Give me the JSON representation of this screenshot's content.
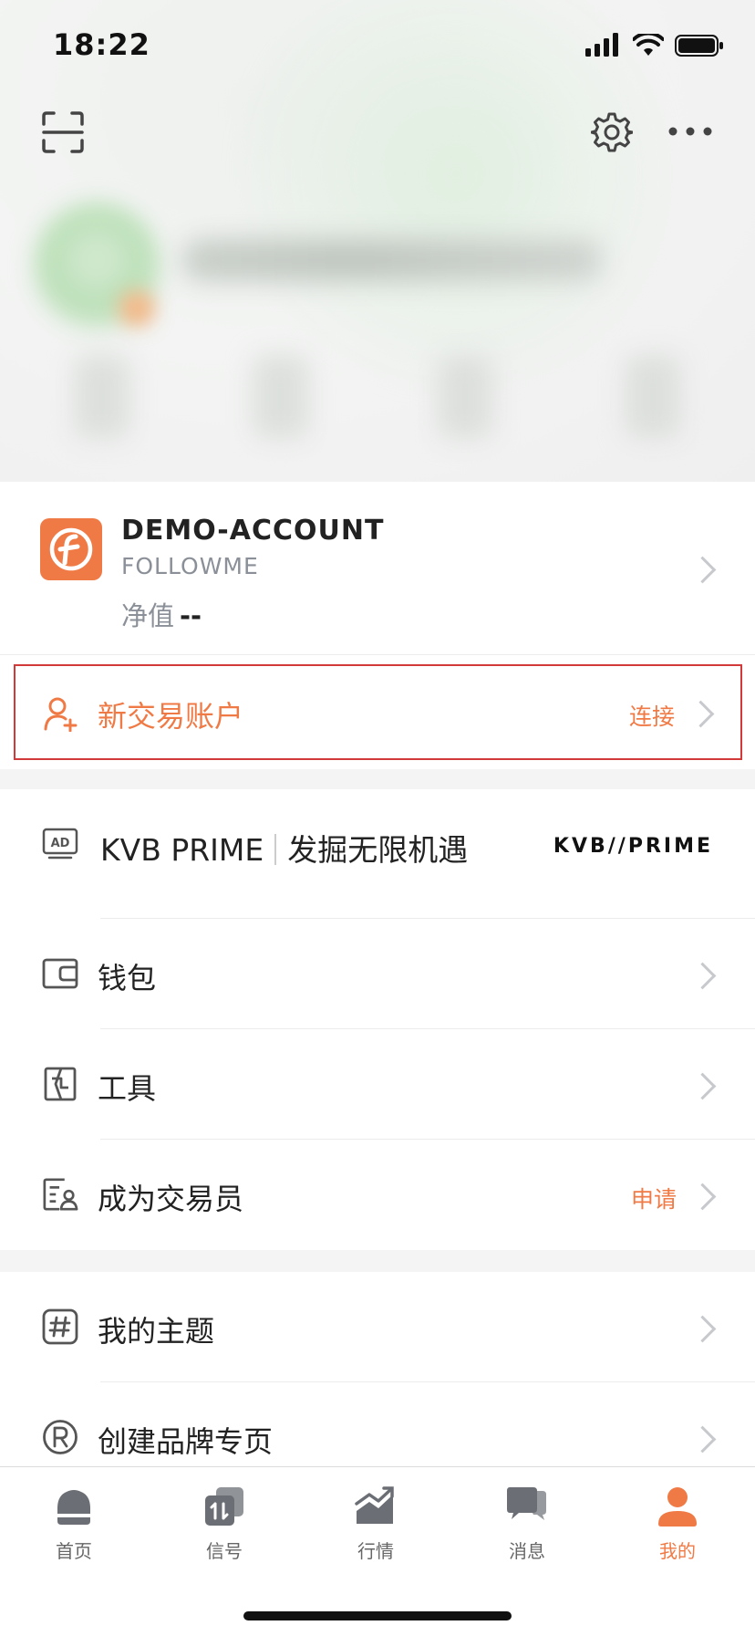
{
  "status_bar": {
    "time": "18:22"
  },
  "header": {
    "scan_icon": "scan-icon",
    "settings_icon": "gear-icon",
    "more_icon": "more-icon"
  },
  "account": {
    "name": "DEMO-ACCOUNT",
    "broker": "FOLLOWME",
    "net_value_label": "净值",
    "net_value": "--"
  },
  "new_account": {
    "label": "新交易账户",
    "action": "连接"
  },
  "ad": {
    "title": "KVB PRIME",
    "slogan": "发掘无限机遇",
    "brand_logo_text": "KVB//PRIME"
  },
  "menu_group1": [
    {
      "label": "钱包",
      "icon": "wallet-icon",
      "right": ""
    },
    {
      "label": "工具",
      "icon": "tools-icon",
      "right": ""
    },
    {
      "label": "成为交易员",
      "icon": "trader-icon",
      "right": "申请"
    }
  ],
  "menu_group2": [
    {
      "label": "我的主题",
      "icon": "hashtag-icon",
      "right": ""
    },
    {
      "label": "创建品牌专页",
      "icon": "registered-icon",
      "right": ""
    }
  ],
  "tabs": [
    {
      "label": "首页",
      "icon": "home-icon",
      "active": false
    },
    {
      "label": "信号",
      "icon": "signal-icon",
      "active": false
    },
    {
      "label": "行情",
      "icon": "market-icon",
      "active": false
    },
    {
      "label": "消息",
      "icon": "message-icon",
      "active": false
    },
    {
      "label": "我的",
      "icon": "profile-icon",
      "active": true
    }
  ],
  "colors": {
    "accent": "#f07a45",
    "highlight_border": "#d23a3a",
    "icon_gray": "#6b6f75"
  }
}
